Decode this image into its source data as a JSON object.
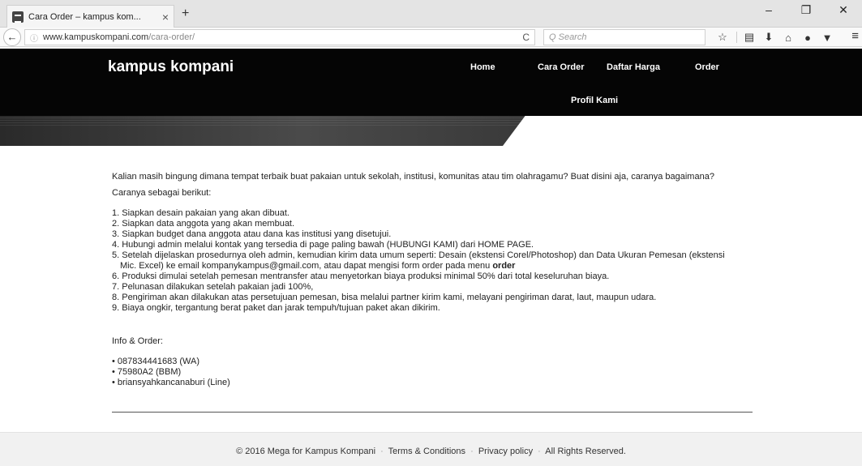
{
  "browser": {
    "tab_title": "Cara Order – kampus kom...",
    "tab_close": "×",
    "new_tab": "+",
    "win_min": "–",
    "win_max": "❐",
    "win_close": "✕",
    "back": "←",
    "url_info": "ⓘ",
    "url_host": "www.kampuskompani.com",
    "url_path": "/cara-order/",
    "reload": "C",
    "search_placeholder": "Q Search",
    "toolbar_icons": [
      "star-icon",
      "reading-list-icon",
      "download-icon",
      "home-icon",
      "chat-icon",
      "pocket-icon"
    ],
    "menu": "≡"
  },
  "site": {
    "brand": "kampus kompani",
    "nav": [
      "Home",
      "Cara Order",
      "Daftar Harga",
      "Order",
      "Profil Kami"
    ]
  },
  "content": {
    "intro": "Kalian masih bingung dimana tempat terbaik buat pakaian untuk sekolah, institusi, komunitas atau tim olahragamu? Buat disini aja, caranya bagaimana?",
    "sub": "Caranya sebagai berikut:",
    "steps": [
      "1. Siapkan desain pakaian yang akan dibuat.",
      "2. Siapkan data anggota yang akan membuat.",
      "3. Siapkan budget dana anggota atau dana kas institusi yang disetujui.",
      "4. Hubungi admin melalui kontak yang tersedia di page paling bawah (HUBUNGI KAMI) dari HOME PAGE.",
      "5. Setelah dijelaskan prosedurnya oleh admin, kemudian kirim data umum seperti: Desain (ekstensi Corel/Photoshop) dan Data Ukuran Pemesan (ekstensi",
      "Mic. Excel) ke email kompanykampus@gmail.com, atau dapat mengisi form order pada menu ",
      "order",
      "6. Produksi dimulai setelah pemesan mentransfer atau menyetorkan biaya produksi minimal 50% dari total keseluruhan biaya.",
      "7. Pelunasan dilakukan setelah pakaian jadi 100%,",
      "8. Pengiriman akan dilakukan atas persetujuan pemesan, bisa melalui partner kirim kami, melayani pengiriman darat, laut, maupun udara.",
      "9. Biaya ongkir, tergantung berat paket dan jarak tempuh/tujuan paket akan dikirim."
    ],
    "info_title": "Info & Order:",
    "contacts": [
      "087834441683 (WA)",
      "75980A2 (BBM)",
      "briansyahkancanaburi (Line)"
    ]
  },
  "footer": {
    "copyright": "© 2016 Mega for Kampus Kompani",
    "terms": "Terms & Conditions",
    "privacy": "Privacy policy",
    "rights": "All Rights Reserved.",
    "sep": "·"
  }
}
